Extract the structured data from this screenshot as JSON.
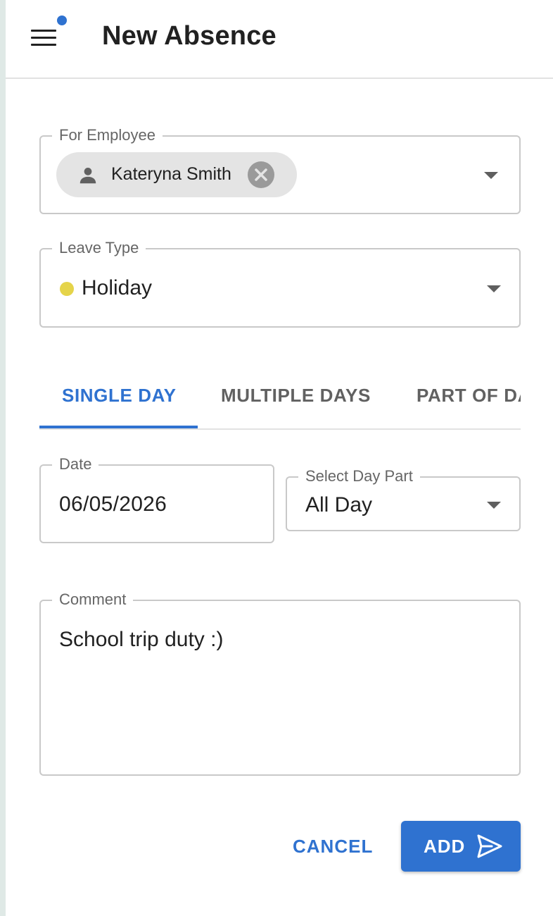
{
  "header": {
    "title": "New Absence",
    "menu_icon": "hamburger-menu-icon",
    "notification_dot_color": "#2f72d0"
  },
  "employee": {
    "label": "For Employee",
    "selected_name": "Kateryna Smith",
    "chip_icon": "person-icon",
    "clear_icon": "clear-circle-icon"
  },
  "leave_type": {
    "label": "Leave Type",
    "value": "Holiday",
    "dot_color": "#e5d44a"
  },
  "tabs": [
    {
      "label": "SINGLE DAY",
      "active": true
    },
    {
      "label": "MULTIPLE DAYS",
      "active": false
    },
    {
      "label": "PART OF DAY",
      "active": false
    }
  ],
  "date": {
    "label": "Date",
    "value": "06/05/2026"
  },
  "day_part": {
    "label": "Select Day Part",
    "value": "All Day"
  },
  "comment": {
    "label": "Comment",
    "value": "School trip duty :)"
  },
  "actions": {
    "cancel_label": "CANCEL",
    "add_label": "ADD",
    "add_icon": "send-icon"
  },
  "colors": {
    "accent": "#2f72d0",
    "border": "#c9c9c9"
  }
}
